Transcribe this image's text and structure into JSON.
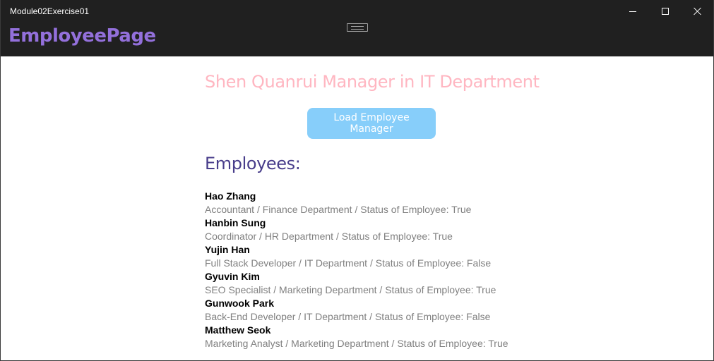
{
  "window": {
    "title": "Module02Exercise01"
  },
  "header": {
    "page_title": "EmployeePage"
  },
  "main": {
    "manager_heading": "Shen Quanrui Manager in IT Department",
    "load_button_label": "Load Employee Manager",
    "employees_heading": "Employees:",
    "employees": [
      {
        "name": "Hao Zhang",
        "detail": "Accountant / Finance Department /  Status of Employee: True"
      },
      {
        "name": "Hanbin Sung",
        "detail": "Coordinator / HR Department /  Status of Employee: True"
      },
      {
        "name": "Yujin Han",
        "detail": "Full Stack Developer / IT Department /  Status of Employee: False"
      },
      {
        "name": "Gyuvin Kim",
        "detail": "SEO Specialist / Marketing Department /  Status of Employee: True"
      },
      {
        "name": "Gunwook Park",
        "detail": "Back-End Developer / IT Department /  Status of Employee: False"
      },
      {
        "name": "Matthew Seok",
        "detail": "Marketing Analyst / Marketing Department /  Status of Employee: True"
      }
    ]
  },
  "colors": {
    "titlebar": "#202020",
    "page_title": "#9370DB",
    "manager_heading": "#FFB6C1",
    "button_bg": "#87CEFA",
    "employees_heading": "#483D8B",
    "detail_text": "#808080"
  },
  "icons": {
    "minimize": "minimize-icon",
    "maximize": "maximize-icon",
    "close": "close-icon",
    "toolbar_handle": "toolbar-handle-icon"
  }
}
